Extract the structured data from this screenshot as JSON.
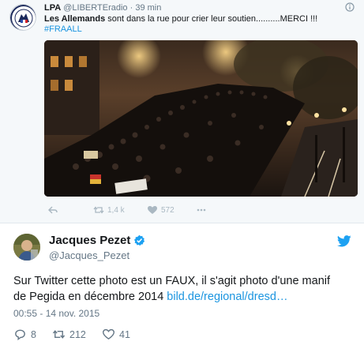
{
  "embedded_tweet": {
    "author_name": "LPA",
    "author_handle": "@LIBERTEradio",
    "separator": "·",
    "time_ago": "39 min",
    "text_bold": "Les Allemands",
    "text_rest": " sont dans la rue pour crier leur soutien..........MERCI !!!",
    "hashtag": "#FRAALL",
    "retweets": "1,4 k",
    "likes": "572"
  },
  "tweet": {
    "author_name": "Jacques Pezet",
    "author_handle": "@Jacques_Pezet",
    "text_line1": "Sur Twitter cette photo est un FAUX, il s'agit photo d'une manif",
    "text_line2_prefix": "de Pegida en décembre 2014 ",
    "link": "bild.de/regional/dresd…",
    "timestamp": "00:55 - 14 nov. 2015",
    "replies": "8",
    "retweets": "212",
    "likes": "41"
  },
  "colors": {
    "link_blue": "#1b95e0",
    "muted_text": "#657786",
    "embedded_bg": "#f5f8fa",
    "verified_blue": "#1da1f2",
    "like_pink": "#e0245e"
  },
  "icons": [
    "info-icon",
    "reply-icon",
    "retweet-icon",
    "heart-icon",
    "more-icon",
    "verified-icon",
    "twitter-bird-icon",
    "comment-icon"
  ]
}
